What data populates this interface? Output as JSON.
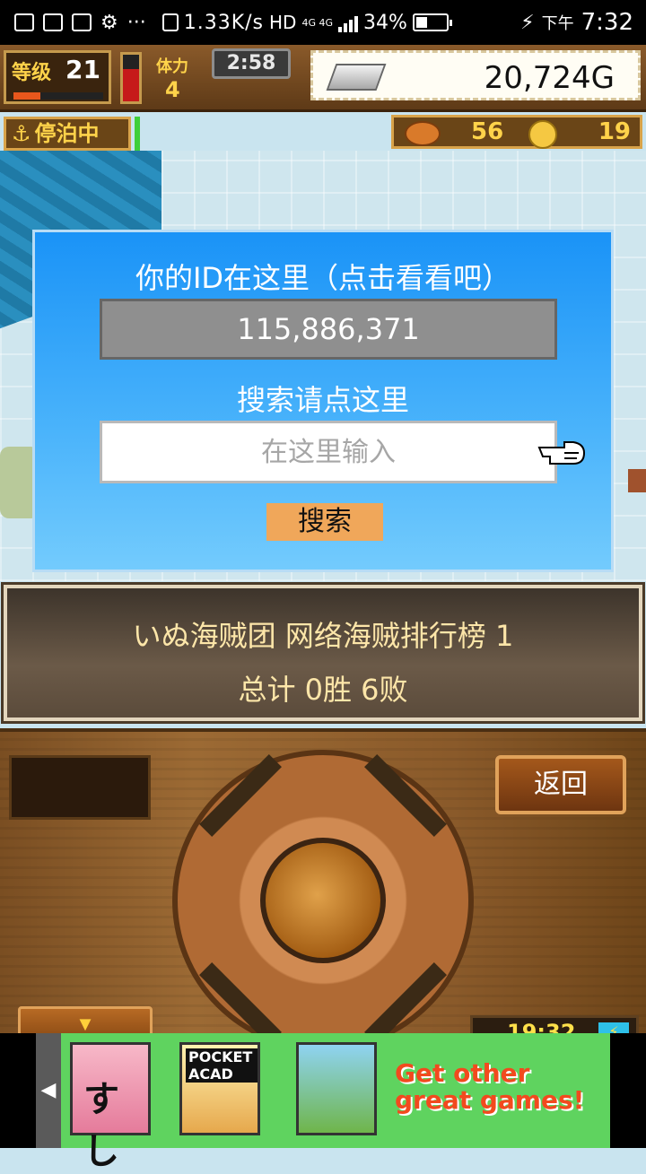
{
  "status_bar": {
    "network_speed": "1.33K/s",
    "hd_label": "HD",
    "network_type": "4G 4G",
    "battery_percent": "34%",
    "am_pm": "下午",
    "time": "7:32"
  },
  "hud": {
    "level_label": "等级",
    "level_value": "21",
    "stamina_label": "体力",
    "stamina_value": "4",
    "timer": "2:58",
    "gold": "20,724G",
    "docked_label": "停泊中",
    "food_count": "56",
    "coin_count": "19"
  },
  "dialog": {
    "title": "你的ID在这里（点击看看吧）",
    "id_value": "115,886,371",
    "search_label": "搜索请点这里",
    "search_placeholder": "在这里输入",
    "search_button": "搜索"
  },
  "info_panel": {
    "team_ranking": "いぬ海贼团  网络海贼排行榜  1",
    "record": "总计 0胜 6败"
  },
  "controller": {
    "back_button": "返回",
    "down_arrow": "▼",
    "game_clock": "19:32",
    "battery_symbol": "⚡"
  },
  "ad": {
    "arrow": "◀",
    "tile1_label": "すし",
    "tile2_label": "POCKET ACAD",
    "cta_line1": "Get other",
    "cta_line2": "great games!"
  }
}
